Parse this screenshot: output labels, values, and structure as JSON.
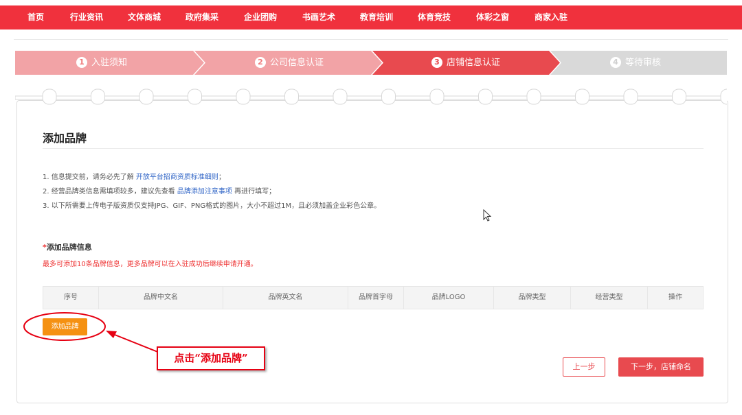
{
  "nav": {
    "items": [
      "首页",
      "行业资讯",
      "文体商城",
      "政府集采",
      "企业团购",
      "书画艺术",
      "教育培训",
      "体育竞技",
      "体彩之窗",
      "商家入驻"
    ]
  },
  "steps": [
    {
      "num": "1",
      "label": "入驻须知",
      "state": "done"
    },
    {
      "num": "2",
      "label": "公司信息认证",
      "state": "done"
    },
    {
      "num": "3",
      "label": "店铺信息认证",
      "state": "active"
    },
    {
      "num": "4",
      "label": "等待审核",
      "state": "pending"
    }
  ],
  "colors": {
    "nav_bg": "#f0313d",
    "step_done": "#f2a3a6",
    "step_active": "#e84a4f",
    "step_pending": "#d9d9d9",
    "add_button": "#f59112",
    "annotation": "#e60012",
    "link": "#2f64c6"
  },
  "main": {
    "title": "添加品牌",
    "tips": [
      {
        "prefix": "1. 信息提交前，请务必先了解 ",
        "link": "开放平台招商资质标准细则",
        "suffix": "；"
      },
      {
        "prefix": "2. 经营品牌类信息需填项较多，建议先查看 ",
        "link": "品牌添加注意事项",
        "suffix": " 再进行填写；"
      },
      {
        "prefix": "3. 以下所需要上传电子版资质仅支持JPG、GIF、PNG格式的图片，大小不超过1M，且必须加盖企业彩色公章。",
        "link": "",
        "suffix": ""
      }
    ],
    "section_star": "*",
    "section_title": "添加品牌信息",
    "section_note": "最多可添加10条品牌信息，更多品牌可以在入驻成功后继续申请开通。",
    "table_headers": [
      "序号",
      "品牌中文名",
      "品牌英文名",
      "品牌首字母",
      "品牌LOGO",
      "品牌类型",
      "经营类型",
      "操作"
    ],
    "add_brand_label": "添加品牌",
    "prev_label": "上一步",
    "next_label": "下一步，店铺命名"
  },
  "annotation": {
    "text": "点击“添加品牌”"
  },
  "icons": {
    "cursor": "mouse-pointer-icon"
  }
}
